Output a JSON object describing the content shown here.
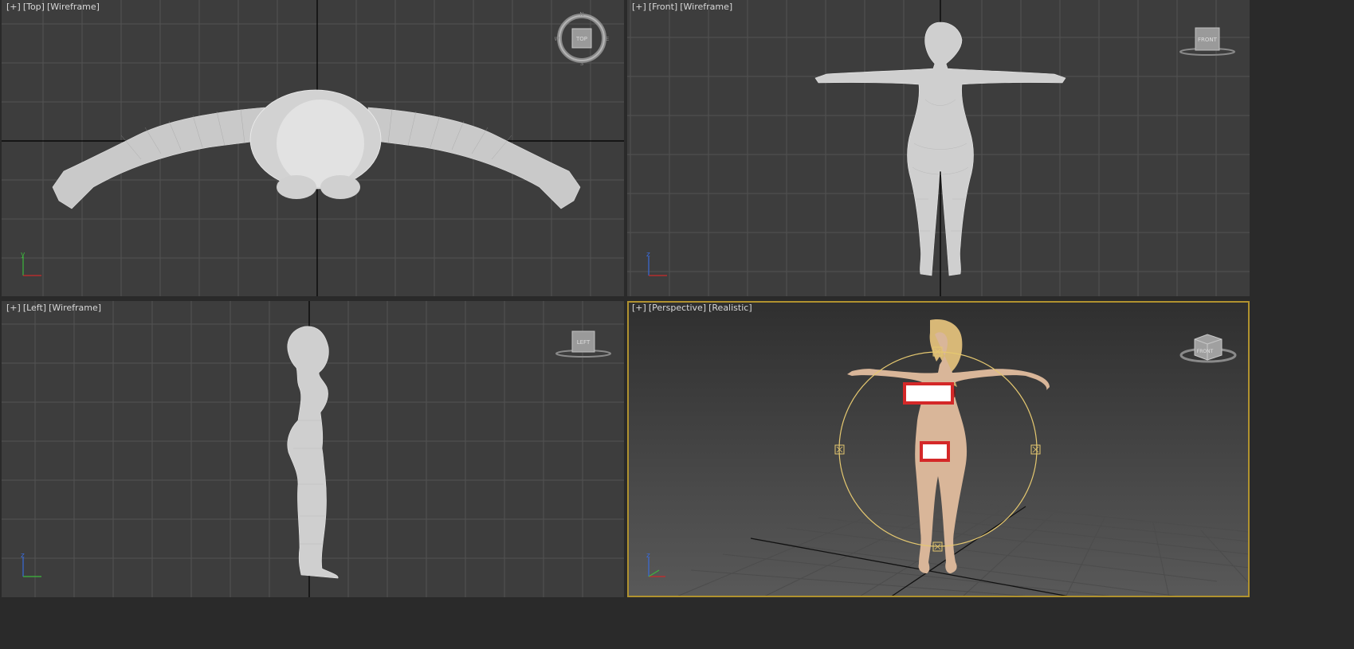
{
  "viewports": {
    "top": {
      "plus": "[+]",
      "name": "[Top]",
      "mode": "[Wireframe]",
      "cube": "TOP"
    },
    "front": {
      "plus": "[+]",
      "name": "[Front]",
      "mode": "[Wireframe]",
      "cube": "FRONT"
    },
    "left": {
      "plus": "[+]",
      "name": "[Left]",
      "mode": "[Wireframe]",
      "cube": "LEFT"
    },
    "persp": {
      "plus": "[+]",
      "name": "[Perspective]",
      "mode": "[Realistic]",
      "cube": "FRONT"
    }
  },
  "compass": {
    "n": "N",
    "s": "S",
    "e": "E",
    "w": "W"
  },
  "axes": {
    "x": "x",
    "y": "y",
    "z": "z"
  },
  "colors": {
    "viewport_bg": "#3d3d3d",
    "grid_line": "#525252",
    "axis_line": "#000000",
    "wireframe": "#d8d8d8",
    "active_border": "#b0922f",
    "gizmo": "#e5c870",
    "skin": "#d9b699",
    "hair": "#d8b877",
    "censor_border": "#d42828"
  }
}
